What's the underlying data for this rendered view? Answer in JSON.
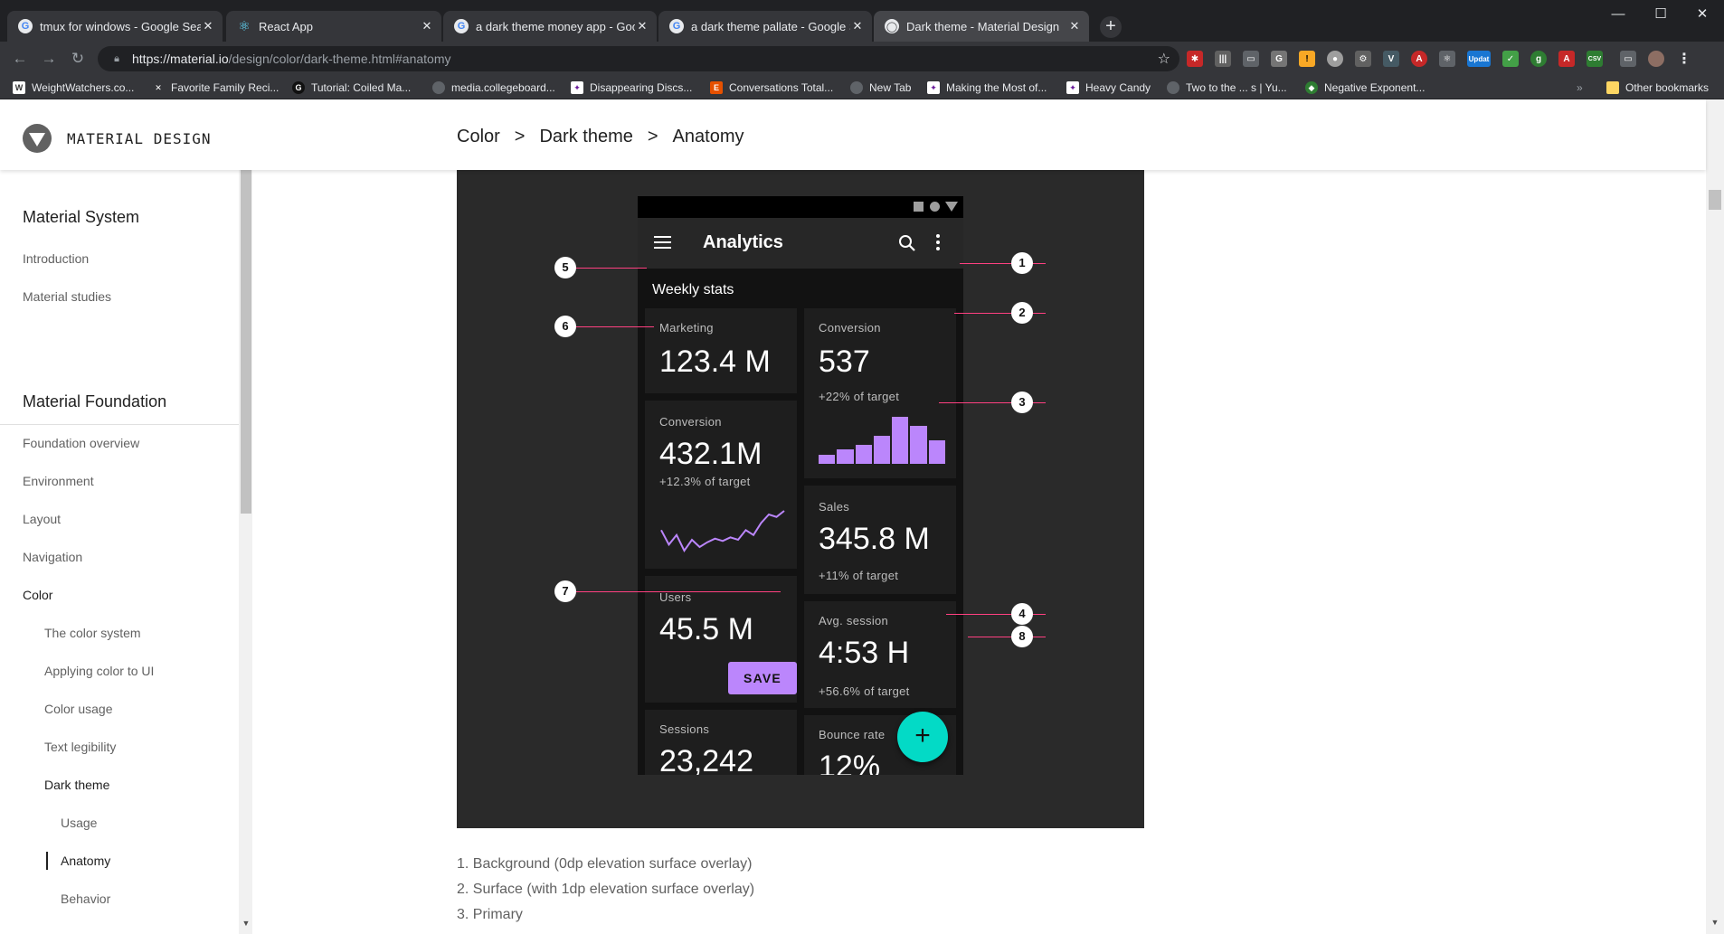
{
  "browser": {
    "tabs": [
      {
        "title": "tmux for windows - Google Search",
        "icon": "google-icon"
      },
      {
        "title": "React App",
        "icon": "react-icon"
      },
      {
        "title": "a dark theme money app - Google Search",
        "icon": "google-icon"
      },
      {
        "title": "a dark theme pallate - Google Search",
        "icon": "google-icon"
      },
      {
        "title": "Dark theme - Material Design",
        "icon": "material-icon"
      }
    ],
    "url_host": "https://material.io",
    "url_path": "/design/color/dark-theme.html#anatomy",
    "bookmarks": [
      "WeightWatchers.co...",
      "Favorite Family Reci...",
      "Tutorial: Coiled Ma...",
      "media.collegeboard...",
      "Disappearing Discs...",
      "Conversations Total...",
      "New Tab",
      "Making the Most of...",
      "Heavy Candy",
      "Two to the ... s | Yu...",
      "Negative Exponent..."
    ],
    "other_bookmarks": "Other bookmarks",
    "extension_badge": "Updat"
  },
  "header": {
    "site_name": "MATERIAL DESIGN",
    "breadcrumb": [
      "Color",
      ">",
      "Dark theme",
      ">",
      "Anatomy"
    ]
  },
  "sidebar": {
    "section1_title": "Material System",
    "section1_items": [
      "Introduction",
      "Material studies"
    ],
    "section2_title": "Material Foundation",
    "section2_items": [
      "Foundation overview",
      "Environment",
      "Layout",
      "Navigation",
      "Color"
    ],
    "color_items": [
      "The color system",
      "Applying color to UI",
      "Color usage",
      "Text legibility",
      "Dark theme"
    ],
    "dark_theme_items": [
      "Usage",
      "Anatomy",
      "Behavior"
    ]
  },
  "figure": {
    "app_title": "Analytics",
    "section_label": "Weekly stats",
    "cards": {
      "marketing": {
        "label": "Marketing",
        "value": "123.4 M"
      },
      "conversion_right": {
        "label": "Conversion",
        "value": "537",
        "sub": "+22% of target"
      },
      "conversion_left": {
        "label": "Conversion",
        "value": "432.1M",
        "sub": "+12.3% of target"
      },
      "sales": {
        "label": "Sales",
        "value": "345.8 M",
        "sub": "+11% of target"
      },
      "users": {
        "label": "Users",
        "value": "45.5 M",
        "button": "SAVE"
      },
      "avg_session": {
        "label": "Avg. session",
        "value": "4:53 H",
        "sub": "+56.6% of target"
      },
      "sessions": {
        "label": "Sessions",
        "value": "23,242"
      },
      "bounce": {
        "label": "Bounce rate",
        "value": "12%"
      }
    },
    "bar_values": [
      2,
      3,
      4,
      6,
      10,
      8,
      5
    ],
    "sparkline": [
      22,
      10,
      18,
      5,
      14,
      8,
      12,
      15,
      13,
      16,
      14,
      22,
      18,
      28,
      35,
      33,
      38
    ],
    "fab_symbol": "+",
    "callouts": [
      "1",
      "2",
      "3",
      "4",
      "5",
      "6",
      "7",
      "8"
    ],
    "colors": {
      "primary": "#bb86fc",
      "secondary": "#03dac6",
      "background": "#121212",
      "surface": "#1e1e1e",
      "callout_line": "#ff4081"
    }
  },
  "legend": [
    "1. Background (0dp elevation surface overlay)",
    "2. Surface (with 1dp elevation surface overlay)",
    "3. Primary"
  ]
}
